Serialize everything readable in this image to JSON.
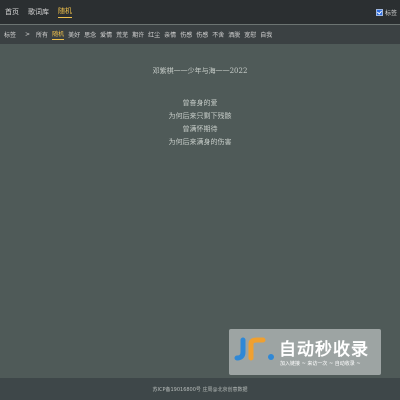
{
  "nav": {
    "items": [
      {
        "label": "首页",
        "active": false
      },
      {
        "label": "歌词库",
        "active": false
      },
      {
        "label": "随机",
        "active": true
      }
    ],
    "show_tags_label": "标签",
    "show_tags_checked": true
  },
  "tags": {
    "label": "标签",
    "arrow": ">",
    "items": [
      {
        "label": "所有",
        "active": false
      },
      {
        "label": "随机",
        "active": true
      },
      {
        "label": "美好",
        "active": false
      },
      {
        "label": "思念",
        "active": false
      },
      {
        "label": "爱情",
        "active": false
      },
      {
        "label": "荒芜",
        "active": false
      },
      {
        "label": "期许",
        "active": false
      },
      {
        "label": "红尘",
        "active": false
      },
      {
        "label": "亲情",
        "active": false
      },
      {
        "label": "伤感",
        "active": false
      },
      {
        "label": "伤感",
        "active": false
      },
      {
        "label": "不舍",
        "active": false
      },
      {
        "label": "洒脱",
        "active": false
      },
      {
        "label": "宽慰",
        "active": false
      },
      {
        "label": "自我",
        "active": false
      }
    ]
  },
  "lyric": {
    "title": "邓紫棋一一少年与海一一2022",
    "lines": [
      "曾奋身的爱",
      "为何后来只剩下残骸",
      "曾满怀期待",
      "为何后来满身的伤害"
    ]
  },
  "watermark": {
    "main": "自动秒收录",
    "sub": "加入链接 ~ 来访一次 ~ 自动收录 ~"
  },
  "footer": {
    "text": "苏ICP备19016800号 庄周@北京创意数据"
  },
  "colors": {
    "background": "#4f5a58",
    "topbar": "#2b2f31",
    "tagsbar": "#3b4143",
    "accent": "#f0c14b",
    "footer": "#3e4749"
  }
}
